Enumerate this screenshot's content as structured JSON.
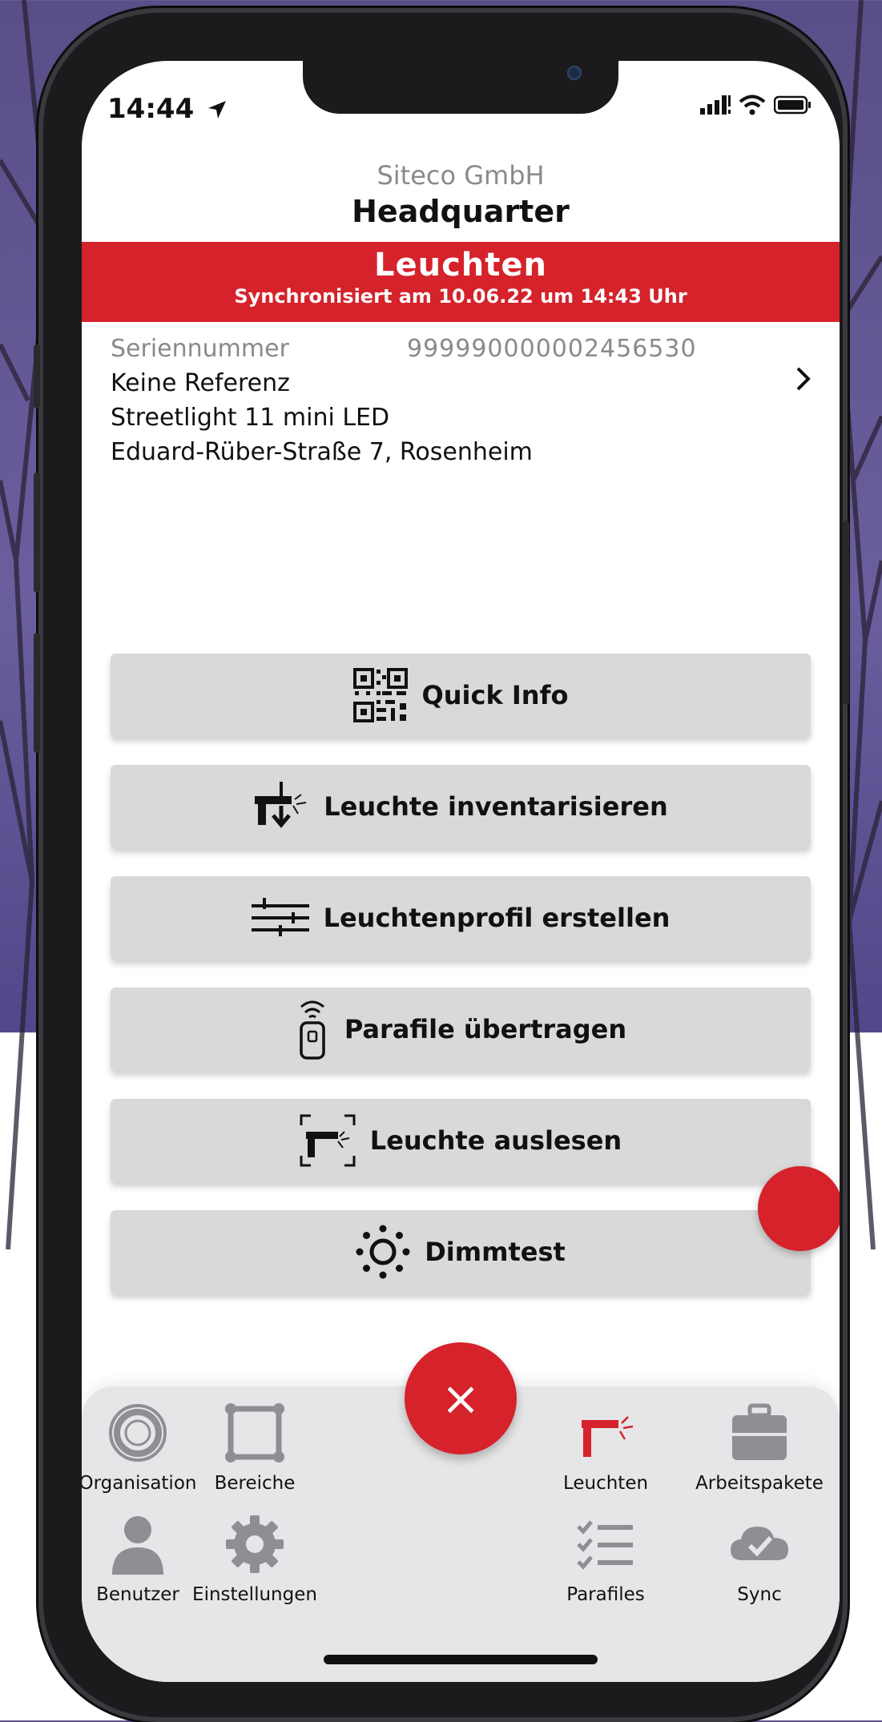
{
  "status": {
    "time": "14:44"
  },
  "header": {
    "company": "Siteco GmbH",
    "location": "Headquarter"
  },
  "banner": {
    "title": "Leuchten",
    "subtitle": "Synchronisiert am 10.06.22 um 14:43 Uhr"
  },
  "luminaire": {
    "serial_label": "Seriennummer",
    "serial_value": "999990000002456530",
    "reference": "Keine Referenz",
    "model": "Streetlight 11 mini LED",
    "address": "Eduard-Rüber-Straße 7, Rosenheim"
  },
  "actions": [
    {
      "label": "Quick Info",
      "icon": "qr-code-icon"
    },
    {
      "label": "Leuchte inventarisieren",
      "icon": "luminaire-download-icon"
    },
    {
      "label": "Leuchtenprofil erstellen",
      "icon": "profile-lines-icon"
    },
    {
      "label": "Parafile übertragen",
      "icon": "remote-transmit-icon"
    },
    {
      "label": "Leuchte auslesen",
      "icon": "luminaire-scan-icon"
    },
    {
      "label": "Dimmtest",
      "icon": "sun-dimmer-icon"
    }
  ],
  "fab": {
    "label": "×"
  },
  "tabs": [
    {
      "label": "Organisation",
      "icon": "organisation-icon",
      "active": false
    },
    {
      "label": "Bereiche",
      "icon": "area-frame-icon",
      "active": false
    },
    {
      "label": "Leuchten",
      "icon": "luminaire-icon",
      "active": true
    },
    {
      "label": "Arbeitspakete",
      "icon": "briefcase-icon",
      "active": false
    },
    {
      "label": "Benutzer",
      "icon": "user-icon",
      "active": false
    },
    {
      "label": "Einstellungen",
      "icon": "gear-icon",
      "active": false
    },
    {
      "label": "Parafiles",
      "icon": "checklist-icon",
      "active": false
    },
    {
      "label": "Sync",
      "icon": "cloud-check-icon",
      "active": false
    }
  ],
  "colors": {
    "accent": "#d5222b",
    "button_bg": "#d9d9d9",
    "tabbar_bg": "#e6e6e8",
    "inactive_icon": "#8e8e93"
  }
}
